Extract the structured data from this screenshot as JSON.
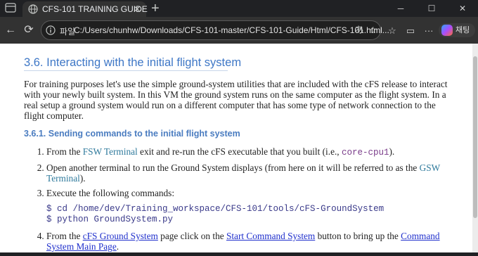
{
  "window": {
    "tab_title": "CFS-101 TRAINING GUIDE",
    "tab_close": "✕",
    "new_tab": "+",
    "minimize": "─",
    "maximize": "☐",
    "close": "✕"
  },
  "toolbar": {
    "back": "←",
    "refresh": "⟳",
    "url_prefix": "파일",
    "url": "C:/Users/chunhw/Downloads/CFS-101-master/CFS-101-Guide/Html/CFS-101.html...",
    "read_aloud": "あ",
    "favorite": "☆",
    "favorites": "☆",
    "collections": "▭",
    "more": "···",
    "copilot_label": "채팅"
  },
  "page": {
    "section_title": "3.6. Interacting with the initial flight system",
    "intro": "For training purposes let's use the simple ground-system utilities that are included with the cFS release to interact with your newly built system. In this VM the ground system runs on the same computer as the flight system. In a real setup a ground system would run on a different computer that has some type of network connection to the flight computer.",
    "subsection_title": "3.6.1. Sending commands to the initial flight system",
    "step1": {
      "pre": "From the ",
      "link": "FSW Terminal",
      "mid": " exit and re-run the cFS executable that you built (i.e., ",
      "code": "core-cpu1",
      "post": ")."
    },
    "step2": {
      "pre": "Open another terminal to run the Ground System displays (from here on it will be referred to as the ",
      "link": "GSW Terminal",
      "post": ")."
    },
    "step3": {
      "text": "Execute the following commands:",
      "cmd1": "$ cd /home/dev/Training_workspace/CFS-101/tools/cFS-GroundSystem",
      "cmd2": "$ python GroundSystem.py"
    },
    "step4": {
      "pre": "From the ",
      "link1": "cFS Ground System",
      "mid1": " page click on the ",
      "link2": "Start Command System",
      "mid2": " button to bring up the ",
      "link3": "Command System Main Page",
      "post": "."
    }
  }
}
